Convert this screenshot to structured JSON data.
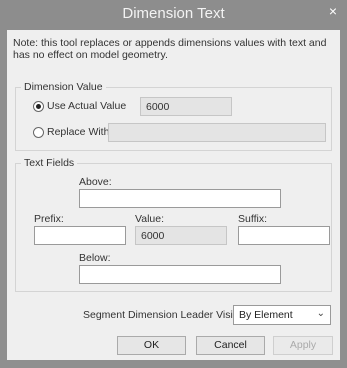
{
  "window": {
    "title": "Dimension Text",
    "close_glyph": "×"
  },
  "note": "Note: this tool replaces or appends dimensions values with text and has no effect on model geometry.",
  "dimension_value": {
    "group_title": "Dimension Value",
    "use_actual_label": "Use Actual Value",
    "use_actual_value": "6000",
    "use_actual_selected": true,
    "replace_label": "Replace With Text",
    "replace_value": ""
  },
  "text_fields": {
    "group_title": "Text Fields",
    "above_label": "Above:",
    "above_value": "",
    "prefix_label": "Prefix:",
    "prefix_value": "",
    "value_label": "Value:",
    "value_value": "6000",
    "suffix_label": "Suffix:",
    "suffix_value": "",
    "below_label": "Below:",
    "below_value": ""
  },
  "leader": {
    "label": "Segment Dimension Leader Visibility:",
    "selected": "By Element",
    "icon": "chevron-down-icon"
  },
  "buttons": {
    "ok": "OK",
    "cancel": "Cancel",
    "apply": "Apply"
  }
}
